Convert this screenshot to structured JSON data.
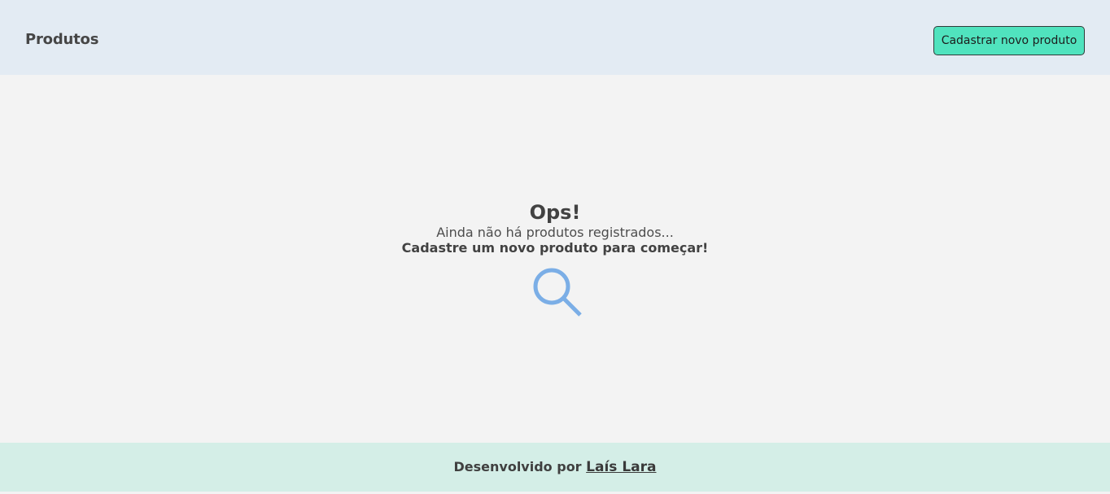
{
  "header": {
    "title": "Produtos",
    "new_product_button": "Cadastrar novo produto"
  },
  "empty_state": {
    "title": "Ops!",
    "subtitle": "Ainda não há produtos registrados...",
    "cta": "Cadastre um novo produto para começar!",
    "icon": "search-icon"
  },
  "footer": {
    "prefix": "Desenvolvido por",
    "author": "Laís Lara"
  },
  "colors": {
    "header_bg": "#e3ebf3",
    "button_bg": "#50e3be",
    "main_bg": "#f3f3f3",
    "footer_bg": "#d4eee7",
    "icon_color": "#7baee6"
  }
}
